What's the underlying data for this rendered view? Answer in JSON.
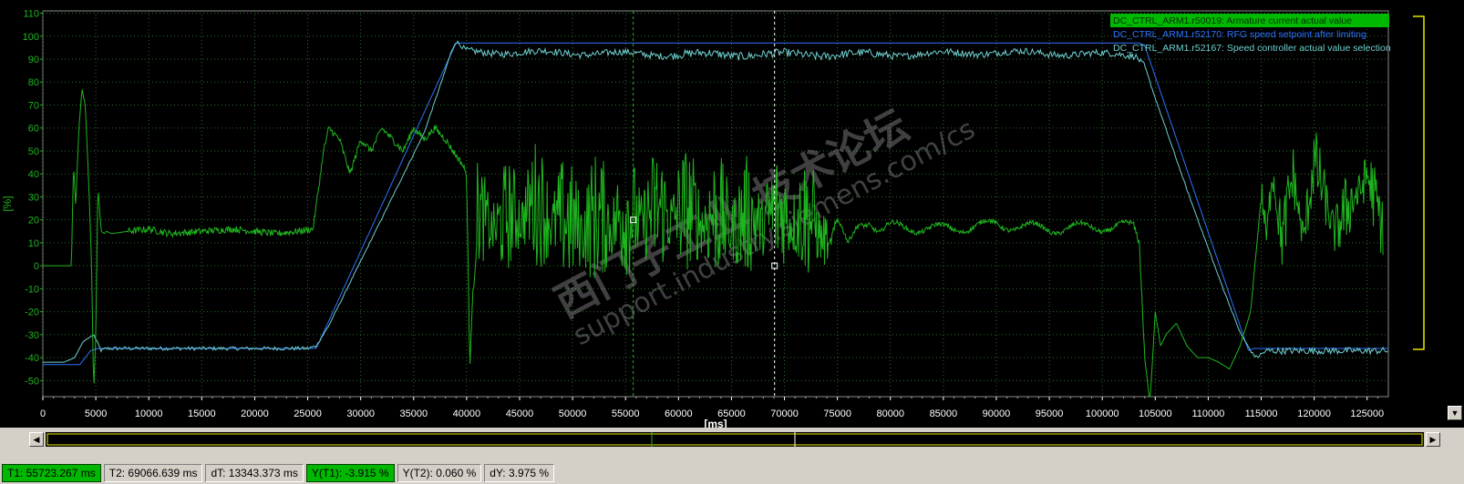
{
  "chart_data": {
    "type": "line",
    "title": "",
    "xlabel": "[ms]",
    "ylabel": "[%]",
    "xlim": [
      0,
      127000
    ],
    "ylim": [
      -57,
      111
    ],
    "x_ticks": [
      0,
      5000,
      10000,
      15000,
      20000,
      25000,
      30000,
      35000,
      40000,
      45000,
      50000,
      55000,
      60000,
      65000,
      70000,
      75000,
      80000,
      85000,
      90000,
      95000,
      100000,
      105000,
      110000,
      115000,
      120000,
      125000
    ],
    "y_ticks": [
      110,
      100,
      90,
      80,
      70,
      60,
      50,
      40,
      30,
      20,
      10,
      0,
      -10,
      -20,
      -30,
      -40,
      -50
    ],
    "grid": true,
    "legend_position": "top-right",
    "watermark": "西门子工业 技术论坛 support.industry.siemens.com/cs",
    "series": [
      {
        "name": "DC_CTRL_ARM1.r50019: Armature current actual value",
        "color": "#1fb51f",
        "x": [
          0,
          2700,
          2900,
          3100,
          3400,
          3700,
          4000,
          4300,
          4600,
          4800,
          5000,
          5200,
          5500,
          5800,
          6000,
          6500,
          8000,
          10000,
          12000,
          15000,
          18000,
          20000,
          22000,
          24000,
          25500,
          26500,
          27000,
          28000,
          29000,
          30000,
          31000,
          32000,
          33000,
          34000,
          35000,
          36000,
          37000,
          38000,
          39000,
          39500,
          40000,
          40300,
          40600,
          41000,
          43000,
          46000,
          50000,
          55000,
          60000,
          65000,
          70000,
          73000,
          74000,
          75000,
          76000,
          77000,
          78000,
          79000,
          80000,
          85000,
          90000,
          95000,
          100000,
          103000,
          103500,
          104000,
          104500,
          105000,
          105500,
          106000,
          107000,
          108000,
          109000,
          110000,
          111000,
          112000,
          113000,
          114000,
          115000,
          115500,
          116000,
          117000,
          118000,
          119000,
          120000,
          122000,
          125000,
          126500
        ],
        "y": [
          0,
          0,
          45,
          25,
          60,
          77,
          70,
          40,
          0,
          -55,
          -30,
          35,
          15,
          14,
          15,
          14,
          15,
          16,
          14,
          15,
          16,
          15,
          14,
          15,
          16,
          50,
          60,
          55,
          40,
          55,
          50,
          60,
          55,
          50,
          60,
          55,
          60,
          55,
          48,
          45,
          40,
          -45,
          -10,
          15,
          10,
          18,
          8,
          12,
          15,
          10,
          14,
          10,
          5,
          20,
          8,
          18,
          20,
          15,
          17,
          16,
          18,
          16,
          17,
          17,
          10,
          -40,
          -60,
          -20,
          -35,
          -30,
          -25,
          -35,
          -40,
          -40,
          -42,
          -45,
          -35,
          -20,
          30,
          10,
          40,
          5,
          35,
          8,
          40,
          10,
          35,
          10
        ],
        "noise": [
          0,
          0,
          0,
          0,
          0,
          0,
          0,
          0,
          0,
          0,
          0,
          0,
          0,
          0,
          0,
          0,
          1.5,
          1.5,
          1.5,
          1.5,
          1.5,
          1.5,
          1.5,
          1.5,
          1.5,
          1.5,
          1.5,
          1.5,
          1.5,
          1.5,
          1.5,
          1.5,
          1.5,
          1.5,
          1.5,
          1.5,
          1.5,
          1.5,
          1.5,
          1.5,
          1.5,
          0,
          6,
          32,
          35,
          40,
          42,
          40,
          40,
          38,
          38,
          30,
          3,
          2,
          2,
          2,
          2,
          2,
          2,
          2,
          2,
          2,
          2,
          1.5,
          1.5,
          0,
          0,
          0,
          0,
          0,
          0,
          0,
          0,
          0,
          0,
          0,
          0,
          0,
          12,
          8,
          20,
          22,
          22,
          22,
          22,
          22,
          22,
          22
        ]
      },
      {
        "name": "DC_CTRL_ARM1.r52170: RFG speed setpoint after limiting",
        "color": "#2f73ff",
        "x": [
          0,
          3500,
          4500,
          5200,
          25800,
          39000,
          103500,
          104000,
          113800,
          114300,
          127000
        ],
        "y": [
          -43,
          -43,
          -37,
          -36,
          -36,
          97,
          97,
          96,
          -37,
          -36,
          -36
        ],
        "noise": [
          0,
          0,
          0,
          0,
          0,
          0,
          0,
          0,
          0,
          0,
          0
        ]
      },
      {
        "name": "DC_CTRL_ARM1.r52167: Speed controller actual value selection",
        "color": "#6fcfcf",
        "x": [
          0,
          2000,
          3000,
          3800,
          4800,
          5500,
          6000,
          10000,
          15000,
          20000,
          25000,
          25800,
          27000,
          30000,
          33000,
          36000,
          38500,
          39000,
          39500,
          40000,
          41000,
          45000,
          60000,
          70000,
          80000,
          90000,
          100000,
          103000,
          104000,
          105000,
          108000,
          111000,
          113000,
          114000,
          114500,
          115500,
          120000,
          127000
        ],
        "y": [
          -42,
          -42,
          -40,
          -33,
          -30,
          -37,
          -36,
          -36,
          -36,
          -36,
          -36,
          -35,
          -26,
          2,
          30,
          58,
          92,
          97,
          95,
          93,
          93,
          93,
          92,
          92,
          92,
          93,
          92,
          92,
          87,
          73,
          33,
          -5,
          -29,
          -37,
          -40,
          -37,
          -37,
          -37
        ],
        "noise": [
          0,
          0,
          0,
          0,
          0.5,
          0.8,
          0.8,
          0.8,
          0.8,
          0.8,
          0.8,
          0.5,
          0.3,
          0.3,
          0.3,
          0.3,
          0.3,
          1,
          1,
          1.5,
          1.5,
          1.5,
          1.8,
          1.8,
          1.5,
          1.5,
          1.5,
          1.2,
          0.5,
          0.3,
          0.3,
          0.3,
          0.3,
          0.5,
          1,
          1.5,
          1.5,
          1.5
        ]
      }
    ],
    "cursors": [
      {
        "label": "T1",
        "x": 55723.267,
        "color": "#1fb51f"
      },
      {
        "label": "T2",
        "x": 69066.639,
        "color": "#ffffff"
      }
    ]
  },
  "status": {
    "t1": "T1: 55723.267 ms",
    "t2": "T2: 69066.639 ms",
    "dt": "dT: 13343.373 ms",
    "yt1": "Y(T1):  -3.915 %",
    "yt2": "Y(T2): 0.060 %",
    "dy": "dY: 3.975 %"
  },
  "scroll": {
    "left_icon": "arrow-left-icon",
    "right_icon": "arrow-right-icon",
    "down_icon": "arrow-down-icon"
  }
}
